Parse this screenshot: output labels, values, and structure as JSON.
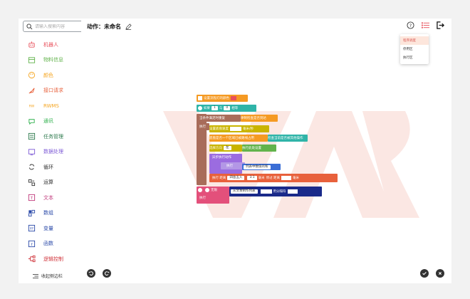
{
  "search": {
    "placeholder": "请输入搜索内容"
  },
  "sidebar": {
    "items": [
      {
        "label": "机器人",
        "icon": "robot-icon",
        "color": "#e8505b"
      },
      {
        "label": "物料信息",
        "icon": "material-icon",
        "color": "#62b34c"
      },
      {
        "label": "颜色",
        "icon": "palette-icon",
        "color": "#f5a623"
      },
      {
        "label": "接口请求",
        "icon": "rocket-icon",
        "color": "#e8613c"
      },
      {
        "label": "RWMS",
        "icon": "rwms-icon",
        "color": "#f5a623"
      },
      {
        "label": "通讯",
        "icon": "chat-icon",
        "color": "#2fb14c"
      },
      {
        "label": "任务管理",
        "icon": "task-icon",
        "color": "#2f7b4f"
      },
      {
        "label": "数据处理",
        "icon": "data-icon",
        "color": "#7e5bd6"
      },
      {
        "label": "循环",
        "icon": "loop-icon",
        "color": "#333333"
      },
      {
        "label": "运算",
        "icon": "calc-icon",
        "color": "#333333"
      },
      {
        "label": "文本",
        "icon": "text-icon",
        "color": "#c0397b"
      },
      {
        "label": "数组",
        "icon": "array-icon",
        "color": "#2a49a8"
      },
      {
        "label": "变量",
        "icon": "variable-icon",
        "color": "#2a49a8"
      },
      {
        "label": "函数",
        "icon": "function-icon",
        "color": "#2a49a8"
      },
      {
        "label": "逻辑控制",
        "icon": "logic-icon",
        "color": "#d0343b"
      }
    ],
    "collapse_label": "收起侧边栏"
  },
  "header": {
    "title": "动作：未命名"
  },
  "menu": {
    "options": [
      "程序调度",
      "停用区",
      "执行区"
    ]
  },
  "blocks": {
    "b1": "设置流程灯的颜色",
    "b2_a": "如果",
    "b2_b": "1",
    "b2_c": "与",
    "b2_d": "0",
    "b2_e": "相等",
    "b3": "当条件满足时重复",
    "b3_b": "律制检查是否到达",
    "b4": "执行",
    "b5": "设置底盘速度",
    "b5_b": "毫米/秒",
    "b6": "底盘是否一个区域已被路线占用",
    "b6_b": "检查当前是否被其他操作",
    "b7": "选择方向",
    "b7_b": "左",
    "b7_c": "执行此处设置",
    "b8": "异步执行动作",
    "b8_b": "执行",
    "b8_c": "列表中数值的和",
    "b9": "执行 距离",
    "b9_b": "四舍五入",
    "b9_c": "3.1",
    "b9_d": "毫米",
    "b9_e": "停过 距离",
    "b9_f": "毫米",
    "b10": "执行",
    "b10_b": "无限",
    "b10_c": "从文本制作列表",
    "b10_d": "用分隔符"
  }
}
